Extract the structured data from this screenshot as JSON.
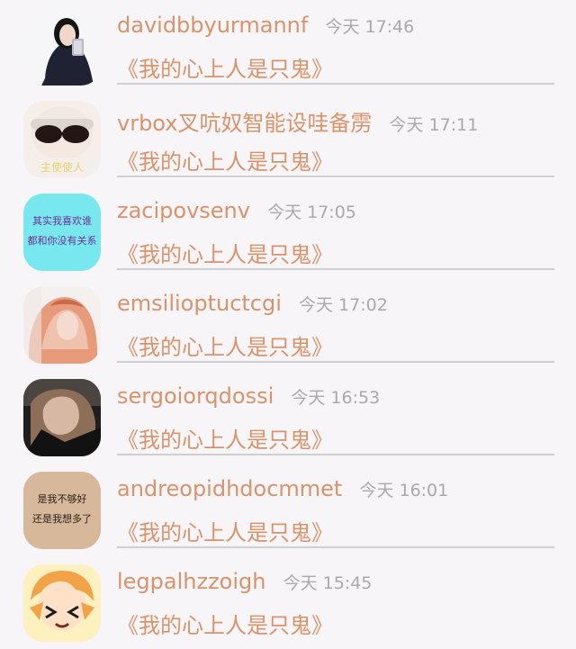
{
  "comments": [
    {
      "username": "davidbbyurmannf",
      "time": "今天 17:46",
      "message": "《我的心上人是只鬼》",
      "avatar": "avatar-selfie"
    },
    {
      "username": "vrbox叉吭奴智能设哇备雳",
      "time": "今天 17:11",
      "message": "《我的心上人是只鬼》",
      "avatar": "avatar-sunglasses",
      "avatar_caption": "主使使人"
    },
    {
      "username": "zacipovsenv",
      "time": "今天 17:05",
      "message": "《我的心上人是只鬼》",
      "avatar": "avatar-text",
      "avatar_text": [
        "其实我喜欢谁",
        "都和你没有关系"
      ]
    },
    {
      "username": "emsilioptuctcgi",
      "time": "今天 17:02",
      "message": "《我的心上人是只鬼》",
      "avatar": "avatar-redhair"
    },
    {
      "username": "sergoiorqdossi",
      "time": "今天 16:53",
      "message": "《我的心上人是只鬼》",
      "avatar": "avatar-dark-photo"
    },
    {
      "username": "andreopidhdocmmet",
      "time": "今天 16:01",
      "message": "《我的心上人是只鬼》",
      "avatar": "avatar-handwriting",
      "avatar_text": [
        "是我不够好",
        "还是我想多了"
      ]
    },
    {
      "username": "legpalhzzoigh",
      "time": "今天 15:45",
      "message": "《我的心上人是只鬼》",
      "avatar": "avatar-cartoon"
    }
  ]
}
